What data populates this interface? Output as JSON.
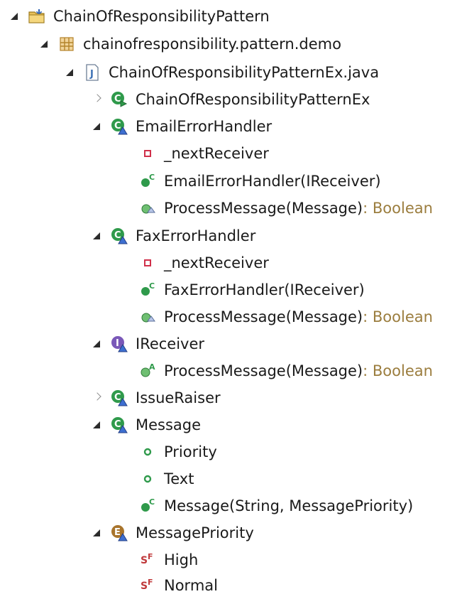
{
  "tree": {
    "project": {
      "label": "ChainOfResponsibilityPattern",
      "icon": "project-folder-icon"
    },
    "package": {
      "label": "chainofresponsibility.pattern.demo",
      "icon": "package-icon"
    },
    "file": {
      "label": "ChainOfResponsibilityPatternEx.java",
      "icon": "java-file-icon"
    },
    "items": [
      {
        "label": "ChainOfResponsibilityPatternEx",
        "icon": "class-run-icon"
      },
      {
        "label": "EmailErrorHandler",
        "icon": "class-icon"
      },
      {
        "label": "_nextReceiver",
        "icon": "private-field-icon"
      },
      {
        "label": "EmailErrorHandler(IReceiver)",
        "icon": "constructor-icon"
      },
      {
        "label": "ProcessMessage(Message)",
        "ret": " : Boolean",
        "icon": "method-implements-icon"
      },
      {
        "label": "FaxErrorHandler",
        "icon": "class-icon"
      },
      {
        "label": "_nextReceiver",
        "icon": "private-field-icon"
      },
      {
        "label": "FaxErrorHandler(IReceiver)",
        "icon": "constructor-icon"
      },
      {
        "label": "ProcessMessage(Message)",
        "ret": " : Boolean",
        "icon": "method-implements-icon"
      },
      {
        "label": "IReceiver",
        "icon": "interface-icon"
      },
      {
        "label": "ProcessMessage(Message)",
        "ret": " : Boolean",
        "icon": "abstract-method-icon"
      },
      {
        "label": "IssueRaiser",
        "icon": "class-icon"
      },
      {
        "label": "Message",
        "icon": "class-icon"
      },
      {
        "label": "Priority",
        "icon": "public-field-icon"
      },
      {
        "label": "Text",
        "icon": "public-field-icon"
      },
      {
        "label": "Message(String, MessagePriority)",
        "icon": "constructor-icon"
      },
      {
        "label": "MessagePriority",
        "icon": "enum-icon"
      },
      {
        "label": "High",
        "icon": "static-final-field-icon"
      },
      {
        "label": "Normal",
        "icon": "static-final-field-icon"
      }
    ]
  }
}
